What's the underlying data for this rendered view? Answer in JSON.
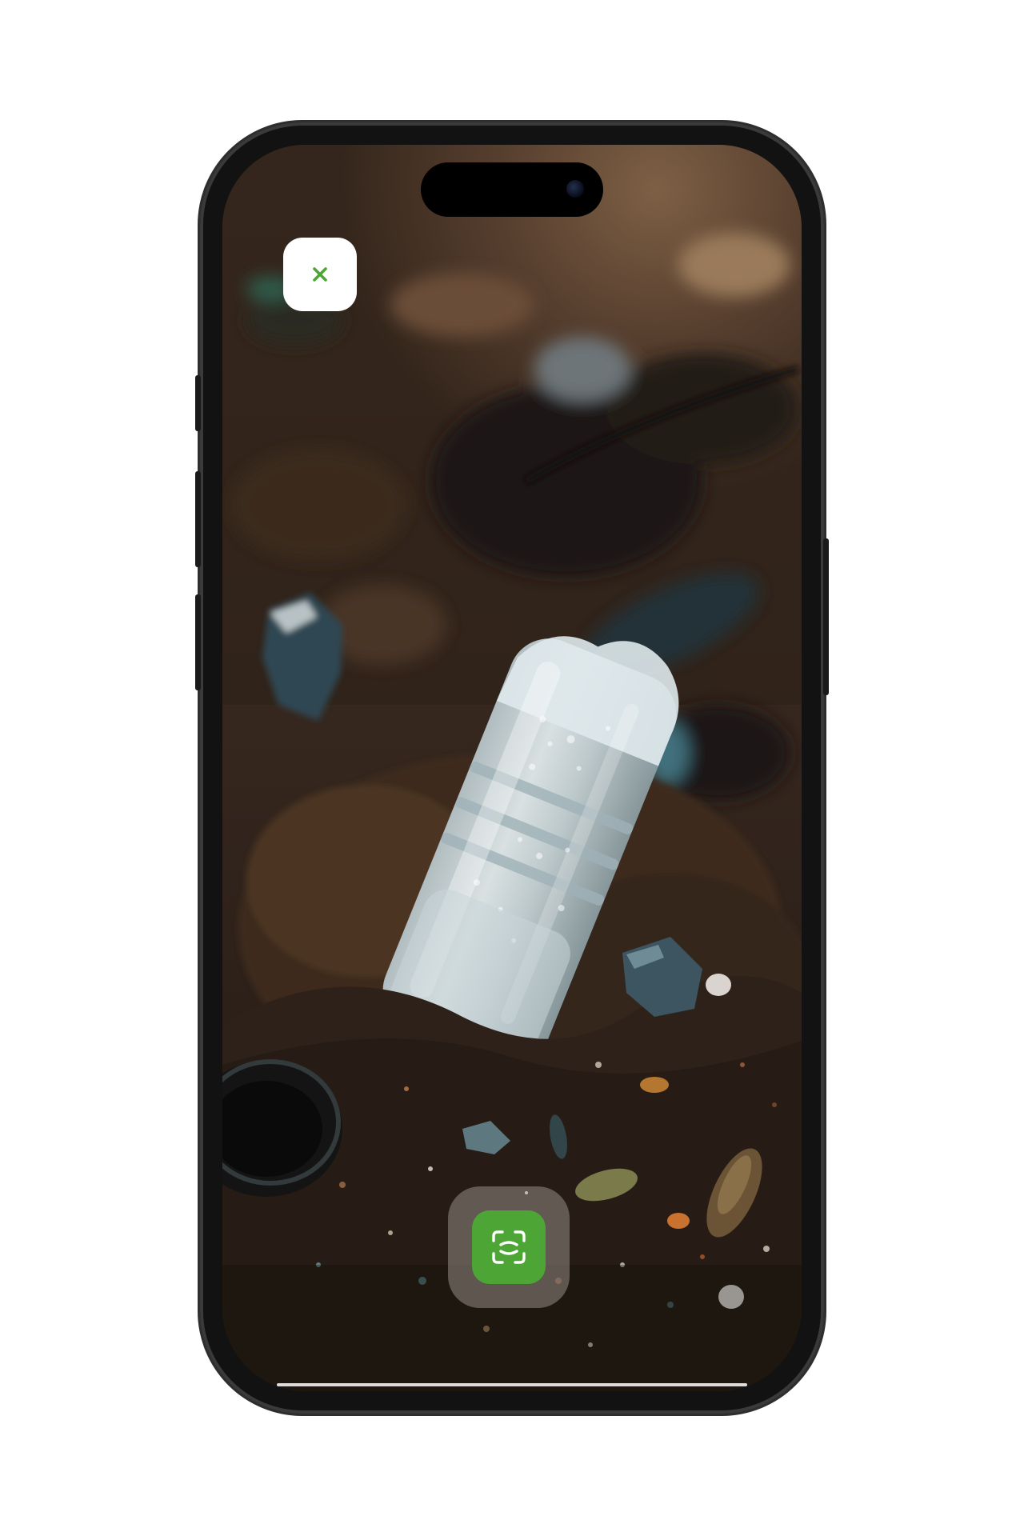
{
  "screen": {
    "view": "camera-scanner",
    "photo_subject": "plastic-bottle-in-soil"
  },
  "close_button": {
    "icon": "close-icon",
    "icon_color": "#4ca535",
    "background": "#ffffff"
  },
  "scan_button": {
    "icon": "scan-icon",
    "background": "#4ca535",
    "icon_color": "#ffffff"
  },
  "colors": {
    "accent": "#4ca535",
    "phone_frame": "#121212",
    "page_background": "#ffffff"
  }
}
